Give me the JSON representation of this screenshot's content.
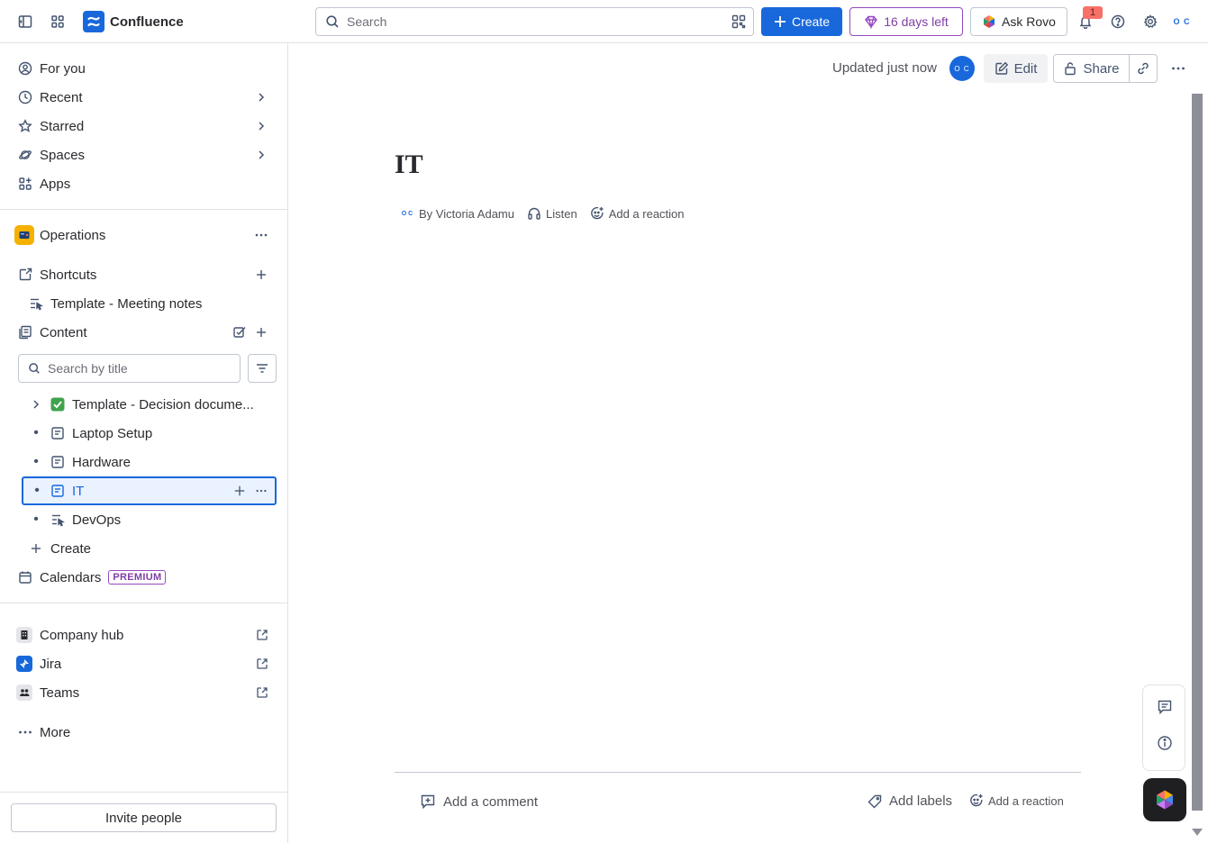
{
  "topbar": {
    "app_name": "Confluence",
    "search_placeholder": "Search",
    "create_label": "Create",
    "trial_label": "16 days left",
    "rovo_label": "Ask Rovo",
    "notification_count": "1",
    "profile_initials": "O C"
  },
  "sidebar": {
    "nav": [
      {
        "label": "For you"
      },
      {
        "label": "Recent"
      },
      {
        "label": "Starred"
      },
      {
        "label": "Spaces"
      },
      {
        "label": "Apps"
      }
    ],
    "space_name": "Operations",
    "shortcuts_label": "Shortcuts",
    "shortcut_item": "Template - Meeting notes",
    "content_label": "Content",
    "search_title_placeholder": "Search by title",
    "tree": [
      {
        "label": "Template - Decision docume..."
      },
      {
        "label": "Laptop Setup"
      },
      {
        "label": "Hardware"
      },
      {
        "label": "IT"
      },
      {
        "label": "DevOps"
      }
    ],
    "create_label": "Create",
    "calendars_label": "Calendars",
    "premium_badge": "PREMIUM",
    "apps": [
      {
        "label": "Company hub"
      },
      {
        "label": "Jira"
      },
      {
        "label": "Teams"
      }
    ],
    "more_label": "More",
    "invite_label": "Invite people"
  },
  "page": {
    "updated_text": "Updated just now",
    "author_initials": "O C",
    "edit_label": "Edit",
    "share_label": "Share",
    "title": "IT",
    "byline_author": "By Victoria Adamu",
    "listen_label": "Listen",
    "reaction_label": "Add a reaction",
    "comment_label": "Add a comment",
    "labels_label": "Add labels",
    "footer_reaction_label": "Add a reaction"
  },
  "colors": {
    "brand_blue": "#1868db",
    "trial_purple": "#964ac0",
    "space_yellow": "#f5b100"
  }
}
